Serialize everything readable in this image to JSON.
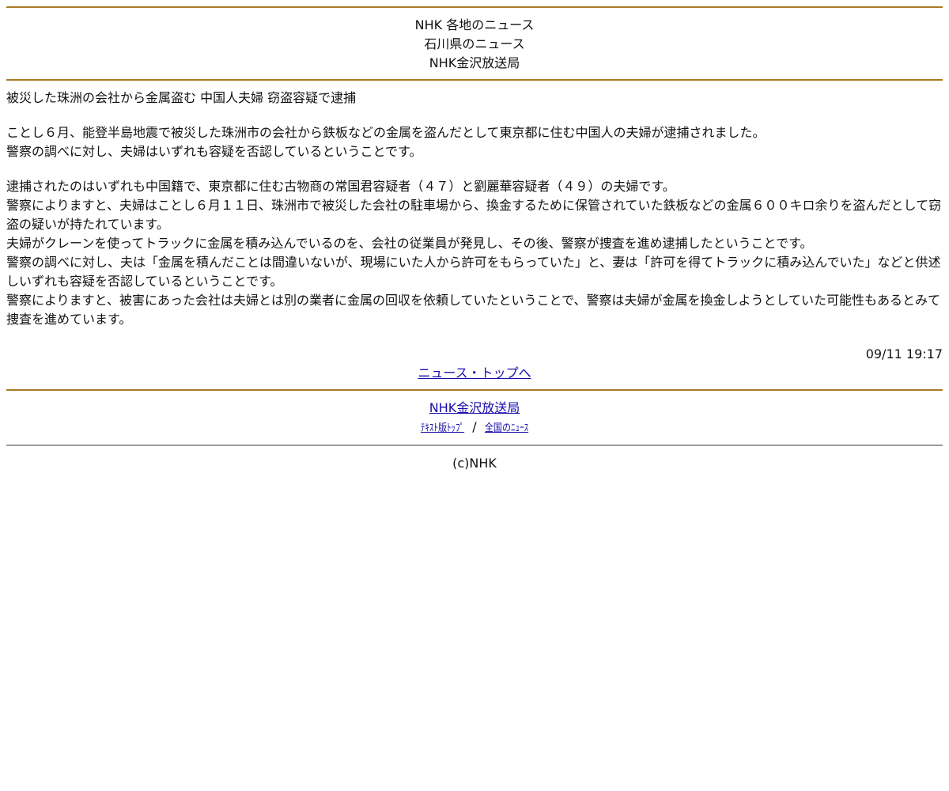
{
  "header": {
    "line1": "NHK 各地のニュース",
    "line2": "石川県のニュース",
    "line3": "NHK金沢放送局"
  },
  "article": {
    "headline": "被災した珠洲の会社から金属盗む 中国人夫婦 窃盗容疑で逮捕",
    "lead": [
      "ことし６月、能登半島地震で被災した珠洲市の会社から鉄板などの金属を盗んだとして東京都に住む中国人の夫婦が逮捕されました。",
      "警察の調べに対し、夫婦はいずれも容疑を否認しているということです。"
    ],
    "body": [
      "逮捕されたのはいずれも中国籍で、東京都に住む古物商の常国君容疑者（４７）と劉麗華容疑者（４９）の夫婦です。",
      "警察によりますと、夫婦はことし６月１１日、珠洲市で被災した会社の駐車場から、換金するために保管されていた鉄板などの金属６００キロ余りを盗んだとして窃盗の疑いが持たれています。",
      "夫婦がクレーンを使ってトラックに金属を積み込んでいるのを、会社の従業員が発見し、その後、警察が捜査を進め逮捕したということです。",
      "警察の調べに対し、夫は「金属を積んだことは間違いないが、現場にいた人から許可をもらっていた」と、妻は「許可を得てトラックに積み込んでいた」などと供述しいずれも容疑を否認しているということです。",
      "警察によりますと、被害にあった会社は夫婦とは別の業者に金属の回収を依頼していたということで、警察は夫婦が金属を換金しようとしていた可能性もあるとみて捜査を進めています。"
    ],
    "timestamp": "09/11 19:17"
  },
  "nav": {
    "news_top": "ニュース・トップへ"
  },
  "footer": {
    "station_link": "NHK金沢放送局",
    "text_top_link": "ﾃｷｽﾄ版ﾄｯﾌﾟ",
    "separator": "/",
    "national_news_link": "全国のﾆｭｰｽ",
    "copyright": "(c)NHK"
  },
  "colors": {
    "rule_gold": "#a87a24",
    "rule_gray": "#9a9a9a",
    "link": "#1a0dab"
  }
}
